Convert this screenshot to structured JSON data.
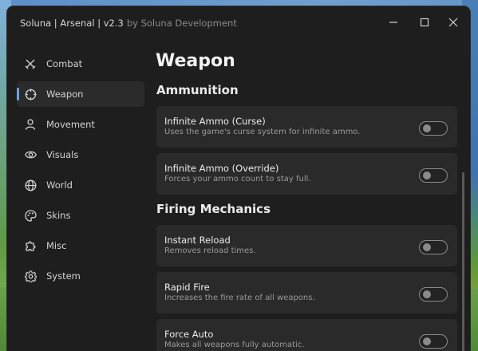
{
  "window": {
    "title": "Soluna | Arsenal | v2.3",
    "subtitle": "by Soluna Development",
    "controls": [
      "minimize-icon",
      "maximize-icon",
      "close-icon"
    ]
  },
  "sidebar": {
    "items": [
      {
        "label": "Combat",
        "icon": "crossed-swords-icon"
      },
      {
        "label": "Weapon",
        "icon": "crosshair-icon",
        "active": true
      },
      {
        "label": "Movement",
        "icon": "person-icon"
      },
      {
        "label": "Visuals",
        "icon": "eye-icon"
      },
      {
        "label": "World",
        "icon": "globe-icon"
      },
      {
        "label": "Skins",
        "icon": "palette-icon"
      },
      {
        "label": "Misc",
        "icon": "puzzle-icon"
      },
      {
        "label": "System",
        "icon": "gear-icon"
      }
    ]
  },
  "main": {
    "title": "Weapon",
    "sections": [
      {
        "title": "Ammunition",
        "options": [
          {
            "label": "Infinite Ammo (Curse)",
            "description": "Uses the game's curse system for infinite ammo.",
            "enabled": false
          },
          {
            "label": "Infinite Ammo (Override)",
            "description": "Forces your ammo count to stay full.",
            "enabled": false
          }
        ]
      },
      {
        "title": "Firing Mechanics",
        "options": [
          {
            "label": "Instant Reload",
            "description": "Removes reload times.",
            "enabled": false
          },
          {
            "label": "Rapid Fire",
            "description": "Increases the fire rate of all weapons.",
            "enabled": false
          },
          {
            "label": "Force Auto",
            "description": "Makes all weapons fully automatic.",
            "enabled": false
          }
        ]
      }
    ]
  },
  "colors": {
    "window_bg": "#1e1e1e",
    "card_bg": "#2a2a2a",
    "accent": "#6ba4e0"
  }
}
